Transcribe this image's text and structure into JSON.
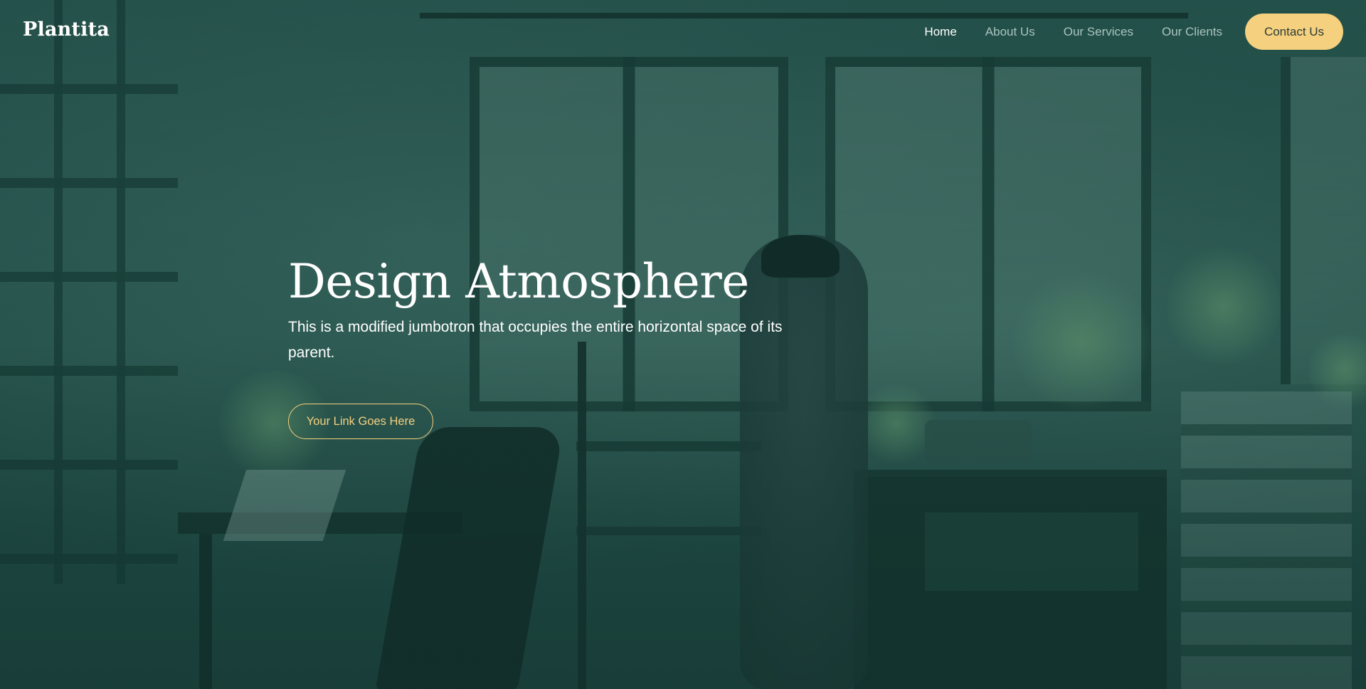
{
  "brand": {
    "logo_text": "Plantita"
  },
  "nav": {
    "items": [
      {
        "label": "Home",
        "active": true
      },
      {
        "label": "About Us",
        "active": false
      },
      {
        "label": "Our Services",
        "active": false
      },
      {
        "label": "Our Clients",
        "active": false
      }
    ],
    "contact_label": "Contact Us"
  },
  "hero": {
    "title": "Design Atmosphere",
    "lead": "This is a modified jumbotron that occupies the entire horizontal space of its parent.",
    "cta_label": "Your Link Goes Here"
  },
  "colors": {
    "overlay": "#24524b",
    "accent": "#f5d07e",
    "nav_inactive": "#aac5bf",
    "text": "#ffffff"
  }
}
